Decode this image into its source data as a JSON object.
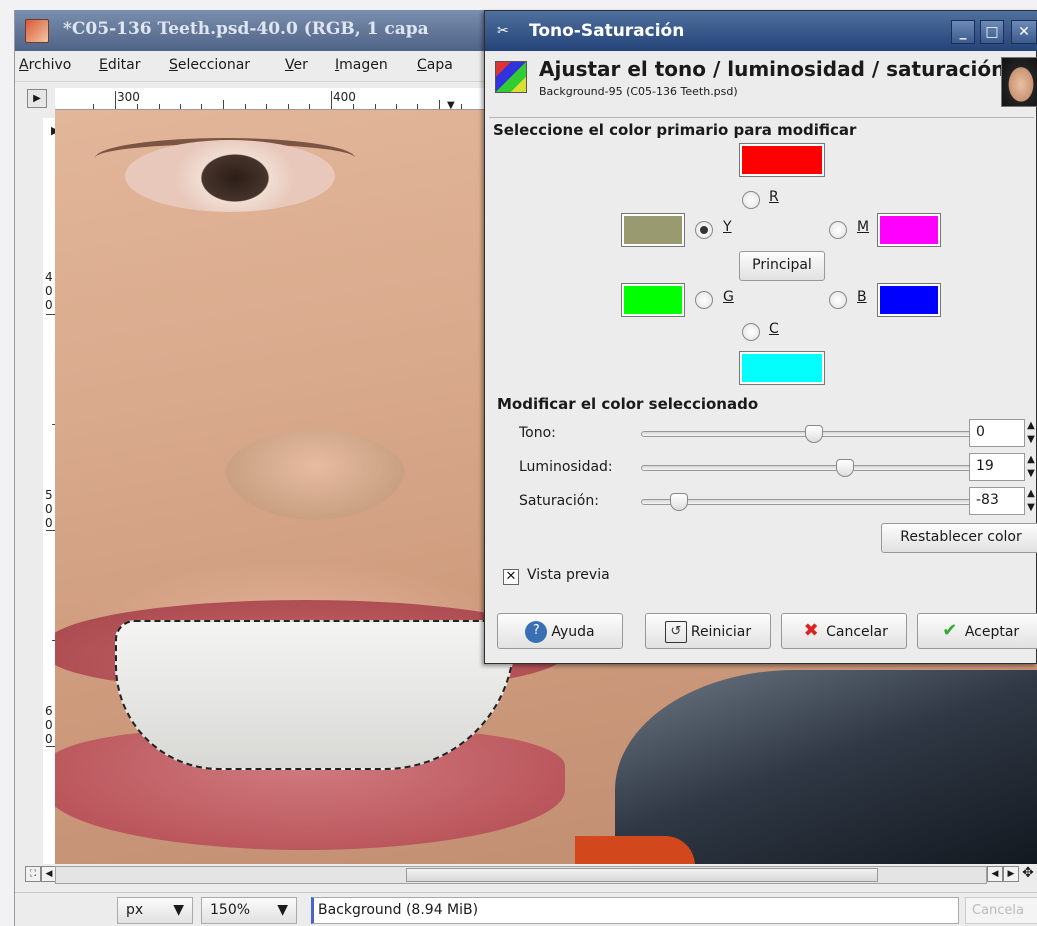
{
  "image_window": {
    "title": "*C05-136 Teeth.psd-40.0 (RGB, 1 capa",
    "menu": [
      {
        "label": "Archivo",
        "mnemonic": "A",
        "rest": "rchivo"
      },
      {
        "label": "Editar",
        "mnemonic": "E",
        "rest": "ditar"
      },
      {
        "label": "Seleccionar",
        "mnemonic": "S",
        "rest": "eleccionar"
      },
      {
        "label": "Ver",
        "mnemonic": "V",
        "rest": "er"
      },
      {
        "label": "Imagen",
        "mnemonic": "I",
        "rest": "magen"
      },
      {
        "label": "Capa",
        "mnemonic": "C",
        "rest": "apa"
      }
    ],
    "ruler_h": [
      "300",
      "400"
    ],
    "ruler_v": [
      "4",
      "0",
      "0",
      "5",
      "0",
      "0",
      "6",
      "0",
      "0"
    ],
    "unit": "px",
    "zoom": "150%",
    "status": "Background (8.94 MiB)",
    "status_cancel": "Cancela"
  },
  "dialog": {
    "title": "Tono-Saturación",
    "header_title": "Ajustar el tono / luminosidad / saturación",
    "header_subtitle": "Background-95 (C05-136 Teeth.psd)",
    "primary_section": "Seleccione el color primario para modificar",
    "channels": {
      "R": "R",
      "Y": "Y",
      "M": "M",
      "G": "G",
      "B": "B",
      "C": "C"
    },
    "selected_channel": "Y",
    "colors": {
      "R": "#ff0000",
      "Y": "#9a9a70",
      "M": "#ff00ff",
      "G": "#00ff00",
      "B": "#0000ff",
      "C": "#00ffff"
    },
    "master_button": "Principal",
    "modify_section": "Modificar el color seleccionado",
    "sliders": {
      "tono": {
        "label": "Tono:",
        "value": "0",
        "fraction": 0.5
      },
      "luminosidad": {
        "label": "Luminosidad:",
        "value": "19",
        "fraction": 0.595
      },
      "saturacion": {
        "label": "Saturación:",
        "value": "-83",
        "fraction": 0.085
      }
    },
    "reset_color_button": "Restablecer color",
    "preview_label": "Vista previa",
    "preview_checked": true,
    "buttons": {
      "help": "Ayuda",
      "reset": "Reiniciar",
      "cancel": "Cancelar",
      "ok": "Aceptar"
    }
  }
}
